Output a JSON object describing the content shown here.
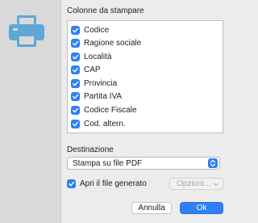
{
  "columns": {
    "title": "Colonne da stampare",
    "items": [
      {
        "label": "Codice",
        "checked": true
      },
      {
        "label": "Ragione sociale",
        "checked": true
      },
      {
        "label": "Località",
        "checked": true
      },
      {
        "label": "CAP",
        "checked": true
      },
      {
        "label": "Provincia",
        "checked": true
      },
      {
        "label": "Partita IVA",
        "checked": true
      },
      {
        "label": "Codice Fiscale",
        "checked": true
      },
      {
        "label": "Cod. altern.",
        "checked": true
      }
    ]
  },
  "destination": {
    "title": "Destinazione",
    "selected": "Stampa su file PDF",
    "open_file_label": "Apri il file generato",
    "open_file_checked": true,
    "options_label": "Opzioni..."
  },
  "buttons": {
    "cancel": "Annulla",
    "ok": "Ok"
  },
  "colors": {
    "accent": "#2f7ff6",
    "sidebar": "#d9d9d9",
    "background": "#ececec",
    "printer_icon": "#5da8d6"
  },
  "icons": {
    "printer": "printer-icon",
    "checkbox": "checkmark-icon",
    "select": "updown-chevron-icon",
    "options": "chevron-down-icon"
  }
}
